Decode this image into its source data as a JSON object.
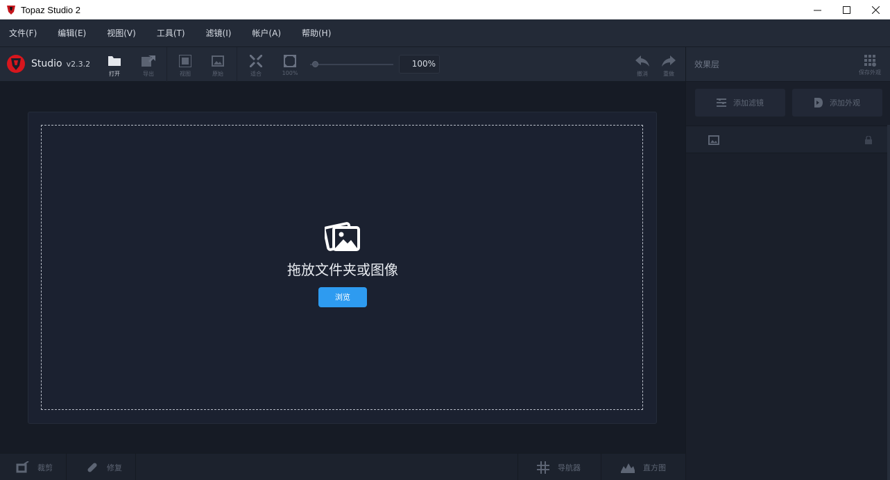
{
  "window": {
    "title": "Topaz Studio 2",
    "controls": [
      "minimize-icon",
      "maximize-icon",
      "close-icon"
    ]
  },
  "menu": {
    "items": [
      "文件(F)",
      "编辑(E)",
      "视图(V)",
      "工具(T)",
      "滤镜(I)",
      "帐户(A)",
      "帮助(H)"
    ]
  },
  "brand": {
    "name": "Studio",
    "version": "v2.3.2"
  },
  "toolbar": {
    "open": "打开",
    "export": "导出",
    "view": "视图",
    "original": "原始",
    "fit": "适合",
    "zoom100": "100%",
    "zoom_value": "100%",
    "undo": "撤消",
    "redo": "重做"
  },
  "panel": {
    "title": "效果层",
    "save_look": "保存外观",
    "add_filter": "添加滤镜",
    "add_look": "添加外观"
  },
  "dropzone": {
    "text": "拖放文件夹或图像",
    "browse": "浏览"
  },
  "bottombar": {
    "crop": "裁剪",
    "repair": "修复",
    "navigator": "导航器",
    "histogram": "直方图"
  },
  "colors": {
    "accent": "#2e9bf0",
    "background": "#1a1f2a",
    "toolbar": "#232a37"
  }
}
